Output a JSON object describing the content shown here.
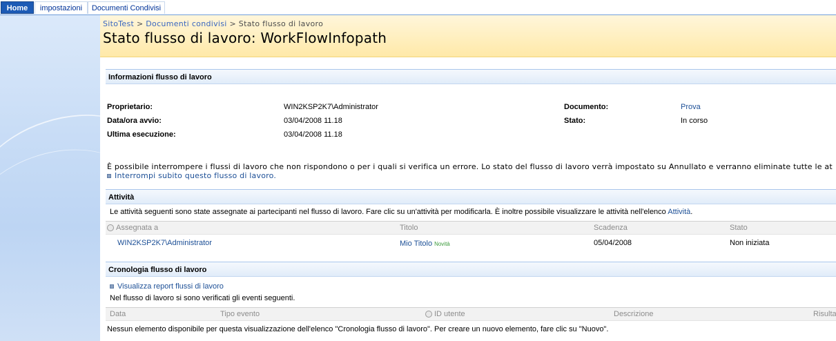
{
  "tabs": [
    {
      "label": "Home"
    },
    {
      "label": "impostazioni"
    },
    {
      "label": "Documenti Condivisi"
    }
  ],
  "breadcrumb": {
    "site": "SitoTest",
    "sep": ">",
    "library": "Documenti condivisi",
    "current": "Stato flusso di lavoro"
  },
  "page_title": "Stato flusso di lavoro: WorkFlowInfopath",
  "info": {
    "header": "Informazioni flusso di lavoro",
    "owner_label": "Proprietario:",
    "owner_value": "WIN2KSP2K7\\Administrator",
    "start_label": "Data/ora avvio:",
    "start_value": "03/04/2008 11.18",
    "last_label": "Ultima esecuzione:",
    "last_value": "03/04/2008 11.18",
    "doc_label": "Documento:",
    "doc_value": "Prova",
    "state_label": "Stato:",
    "state_value": "In corso",
    "notice": "È possibile interrompere i flussi di lavoro che non rispondono o per i quali si verifica un errore. Lo stato del flusso di lavoro verrà impostato su Annullato e verranno eliminate tutte le at",
    "stop_link": "Interrompi subito questo flusso di lavoro."
  },
  "tasks": {
    "header": "Attività",
    "intro": "Le attività seguenti sono state assegnate ai partecipanti nel flusso di lavoro. Fare clic su un'attività per modificarla. È inoltre possibile visualizzare le attività nell'elenco",
    "intro_link": "Attività",
    "intro_end": ".",
    "columns": [
      "Assegnata a",
      "Titolo",
      "Scadenza",
      "Stato"
    ],
    "rows": [
      {
        "assigned": "WIN2KSP2K7\\Administrator",
        "title": "Mio Titolo",
        "badge": "Novità",
        "due": "05/04/2008",
        "state": "Non iniziata"
      }
    ]
  },
  "history": {
    "header": "Cronologia flusso di lavoro",
    "report_link": "Visualizza report flussi di lavoro",
    "intro": "Nel flusso di lavoro si sono verificati gli eventi seguenti.",
    "columns": [
      "Data",
      "Tipo evento",
      "ID utente",
      "Descrizione",
      "Risulta"
    ],
    "empty": "Nessun elemento disponibile per questa visualizzazione dell'elenco \"Cronologia flusso di lavoro\". Per creare un nuovo elemento, fare clic su \"Nuovo\"."
  },
  "colors": {
    "tab_active": "#1d5bb5",
    "link": "#1c4f96",
    "title_bg": "#ffe9a8",
    "nav_bg": "#c9ddf6",
    "new_badge": "#3a9a3a"
  }
}
